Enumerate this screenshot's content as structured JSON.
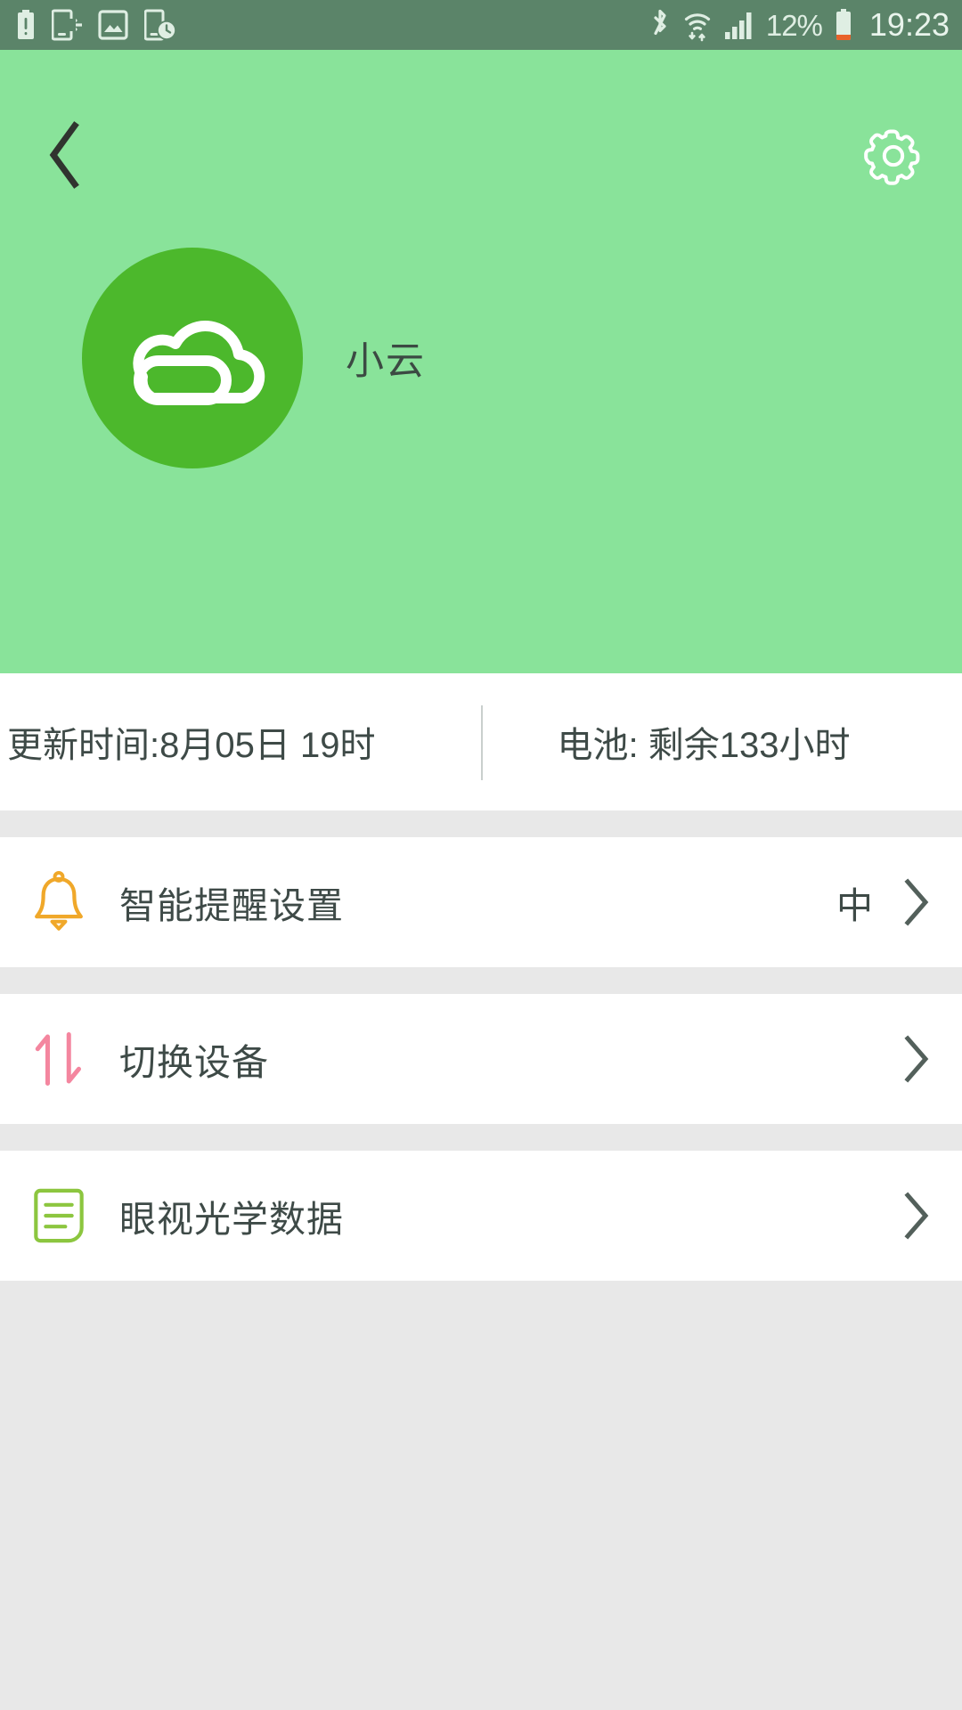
{
  "status_bar": {
    "icons_left": [
      "battery-alert-icon",
      "phone-transfer-icon",
      "screenshot-image-icon",
      "phone-clock-icon"
    ],
    "icons_right": [
      "bluetooth-icon",
      "wifi-icon",
      "cellular-signal-icon"
    ],
    "battery_percent": "12%",
    "clock": "19:23",
    "background_color": "#5b8469",
    "foreground_color": "#e0eee4",
    "battery_low_color": "#e8622a"
  },
  "header": {
    "background_color": "#89e39a",
    "back_icon": "chevron-left-icon",
    "settings_icon": "gear-icon",
    "avatar_icon": "cloud-logo-icon",
    "avatar_color": "#4cb82c",
    "nickname": "小云"
  },
  "info": {
    "update_time": "更新时间:8月05日 19时",
    "battery": "电池: 剩余133小时"
  },
  "list": {
    "rows": [
      {
        "icon": "bell-icon",
        "icon_color": "#f0a82a",
        "label": "智能提醒设置",
        "value": "中",
        "chevron": "chevron-right-icon"
      },
      {
        "icon": "swap-arrows-icon",
        "icon_color": "#f4869f",
        "label": "切换设备",
        "value": "",
        "chevron": "chevron-right-icon"
      },
      {
        "icon": "document-lines-icon",
        "icon_color": "#8cc63f",
        "label": "眼视光学数据",
        "value": "",
        "chevron": "chevron-right-icon"
      }
    ]
  },
  "theme": {
    "page_background": "#e8e8e8",
    "card_background": "#ffffff",
    "text_color": "#3e4a47"
  }
}
